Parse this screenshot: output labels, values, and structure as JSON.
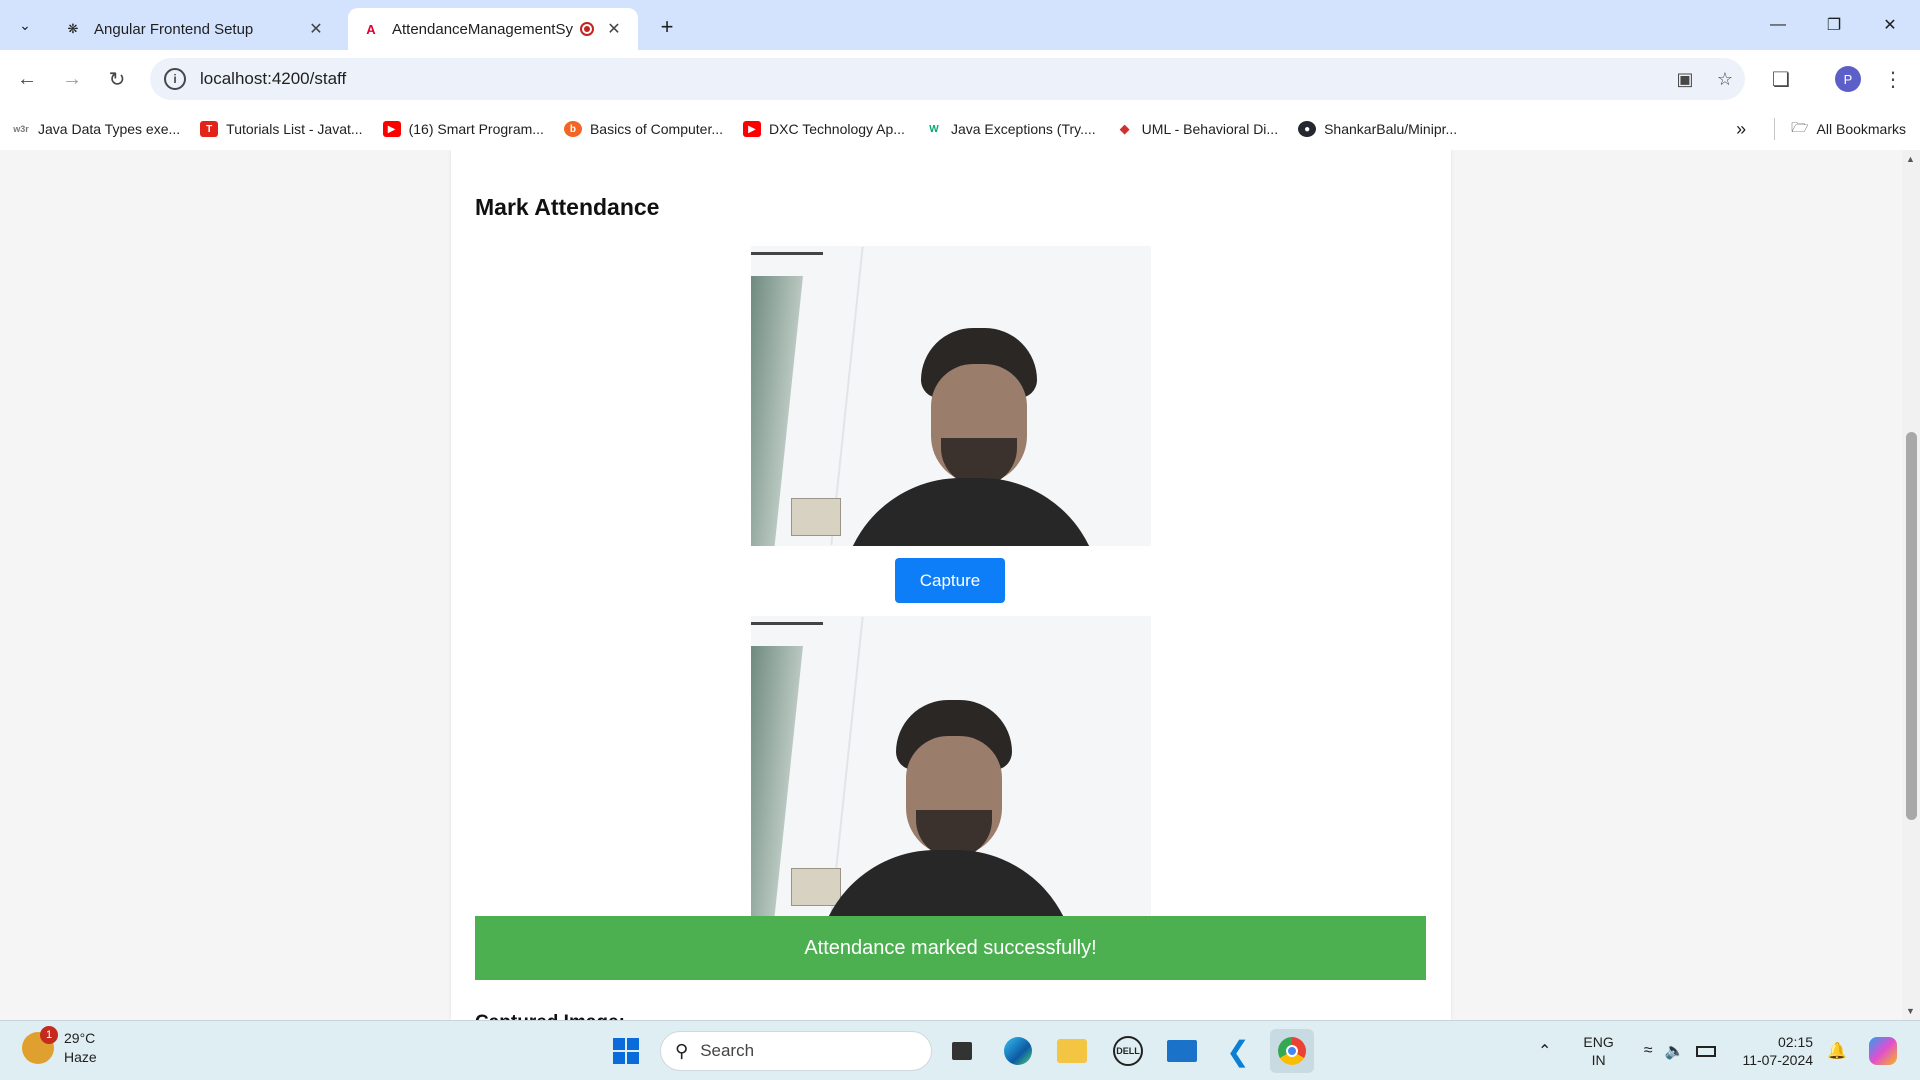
{
  "browser": {
    "tabs": [
      {
        "title": "Angular Frontend Setup",
        "favicon": "openai-icon",
        "active": false
      },
      {
        "title": "AttendanceManagementSy",
        "favicon": "angular-icon",
        "active": true,
        "recording": true
      }
    ],
    "url": "localhost:4200/staff",
    "profile_initial": "P",
    "bookmarks": [
      {
        "label": "Java Data Types exe...",
        "icon": "w3r",
        "color": "#7a7a7a"
      },
      {
        "label": "Tutorials List - Javat...",
        "icon": "T",
        "color": "#e2231a"
      },
      {
        "label": "(16) Smart Program...",
        "icon": "▶",
        "color": "#ff0000"
      },
      {
        "label": "Basics of Computer...",
        "icon": "b",
        "color": "#f26522"
      },
      {
        "label": "DXC Technology Ap...",
        "icon": "▶",
        "color": "#ff0000"
      },
      {
        "label": "Java Exceptions (Try....",
        "icon": "W",
        "color": "#04aa6d"
      },
      {
        "label": "UML - Behavioral Di...",
        "icon": "◆",
        "color": "#d32f2f"
      },
      {
        "label": "ShankarBalu/Minipr...",
        "icon": "●",
        "color": "#24292f"
      }
    ],
    "all_bookmarks_label": "All Bookmarks"
  },
  "page": {
    "heading": "Mark Attendance",
    "capture_label": "Capture",
    "success_message": "Attendance marked successfully!",
    "captured_label": "Captured Image:"
  },
  "taskbar": {
    "temperature": "29°C",
    "weather": "Haze",
    "weather_badge": "1",
    "search_placeholder": "Search",
    "lang_line1": "ENG",
    "lang_line2": "IN",
    "time": "02:15",
    "date": "11-07-2024"
  }
}
